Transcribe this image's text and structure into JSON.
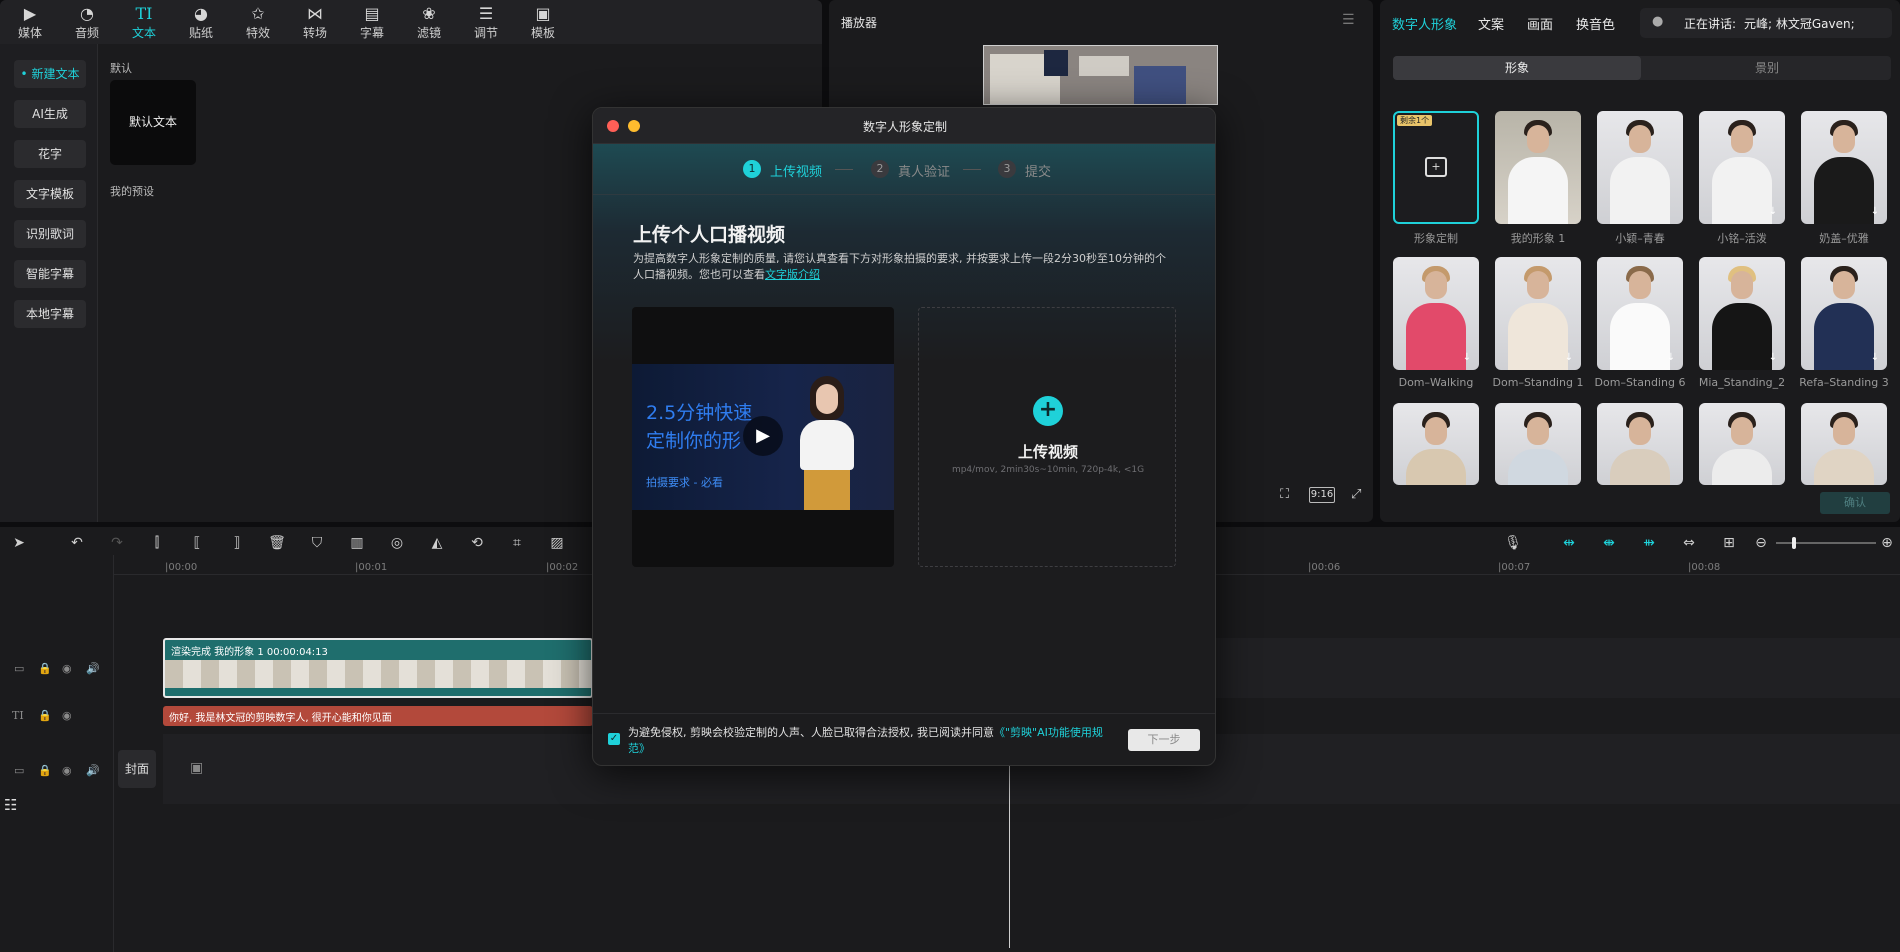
{
  "toolbar": {
    "items": [
      {
        "label": "媒体",
        "icon": "media-icon"
      },
      {
        "label": "音频",
        "icon": "audio-icon"
      },
      {
        "label": "文本",
        "icon": "text-icon"
      },
      {
        "label": "贴纸",
        "icon": "sticker-icon"
      },
      {
        "label": "特效",
        "icon": "effects-icon"
      },
      {
        "label": "转场",
        "icon": "transition-icon"
      },
      {
        "label": "字幕",
        "icon": "subtitle-icon"
      },
      {
        "label": "滤镜",
        "icon": "filter-icon"
      },
      {
        "label": "调节",
        "icon": "adjust-icon"
      },
      {
        "label": "模板",
        "icon": "template-icon"
      }
    ],
    "active_index": 2
  },
  "text_panel": {
    "sidebar": [
      "新建文本",
      "AI生成",
      "花字",
      "文字模板",
      "识别歌词",
      "智能字幕",
      "本地字幕"
    ],
    "section_default": "默认",
    "default_card": "默认文本",
    "section_presets": "我的预设"
  },
  "player": {
    "title": "播放器",
    "ratio": "9:16"
  },
  "right_panel": {
    "tabs": [
      "数字人形象",
      "文案",
      "画面",
      "换音色"
    ],
    "speaking_label": "正在讲话:",
    "speaking_value": "元峰; 林文冠Gaven;",
    "subtabs": [
      "形象",
      "景别"
    ],
    "avatars": [
      {
        "label": "形象定制",
        "badge": "剩余1个"
      },
      {
        "label": "我的形象 1"
      },
      {
        "label": "小颖–青春"
      },
      {
        "label": "小铭–活泼"
      },
      {
        "label": "奶盖–优雅"
      },
      {
        "label": "Dom–Walking"
      },
      {
        "label": "Dom–Standing 1"
      },
      {
        "label": "Dom–Standing 6"
      },
      {
        "label": "Mia_Standing_2"
      },
      {
        "label": "Refa–Standing 3"
      },
      {
        "label": ""
      },
      {
        "label": ""
      },
      {
        "label": ""
      },
      {
        "label": ""
      },
      {
        "label": ""
      }
    ],
    "confirm": "确认"
  },
  "timeline": {
    "ticks": [
      "00:00",
      "00:01",
      "00:02",
      "00:06",
      "00:07",
      "00:08"
    ],
    "video_clip_label": "渲染完成  我的形象 1  00:00:04:13",
    "text_clip_label": "你好, 我是林文冠的剪映数字人, 很开心能和你见面",
    "cover_label": "封面"
  },
  "modal": {
    "title": "数字人形象定制",
    "steps": [
      {
        "num": "1",
        "label": "上传视频"
      },
      {
        "num": "2",
        "label": "真人验证"
      },
      {
        "num": "3",
        "label": "提交"
      }
    ],
    "heading": "上传个人口播视频",
    "desc": "为提高数字人形象定制的质量, 请您认真查看下方对形象拍摄的要求, 并按要求上传一段2分30秒至10分钟的个人口播视频。您也可以查看",
    "desc_link": "文字版介绍",
    "video_line1": "2.5分钟快速",
    "video_line2": "定制你的形",
    "video_sub": "拍摄要求 - 必看",
    "upload_title": "上传视频",
    "upload_hint": "mp4/mov, 2min30s~10min, 720p-4k, <1G",
    "agree_text": "为避免侵权, 剪映会校验定制的人声、人脸已取得合法授权, 我已阅读并同意",
    "agree_link": "《\"剪映\"AI功能使用规范》",
    "next": "下一步"
  },
  "colors": {
    "accent": "#1fd1d9",
    "text_clip": "#b3493b",
    "video_clip": "#1f6e6d"
  }
}
